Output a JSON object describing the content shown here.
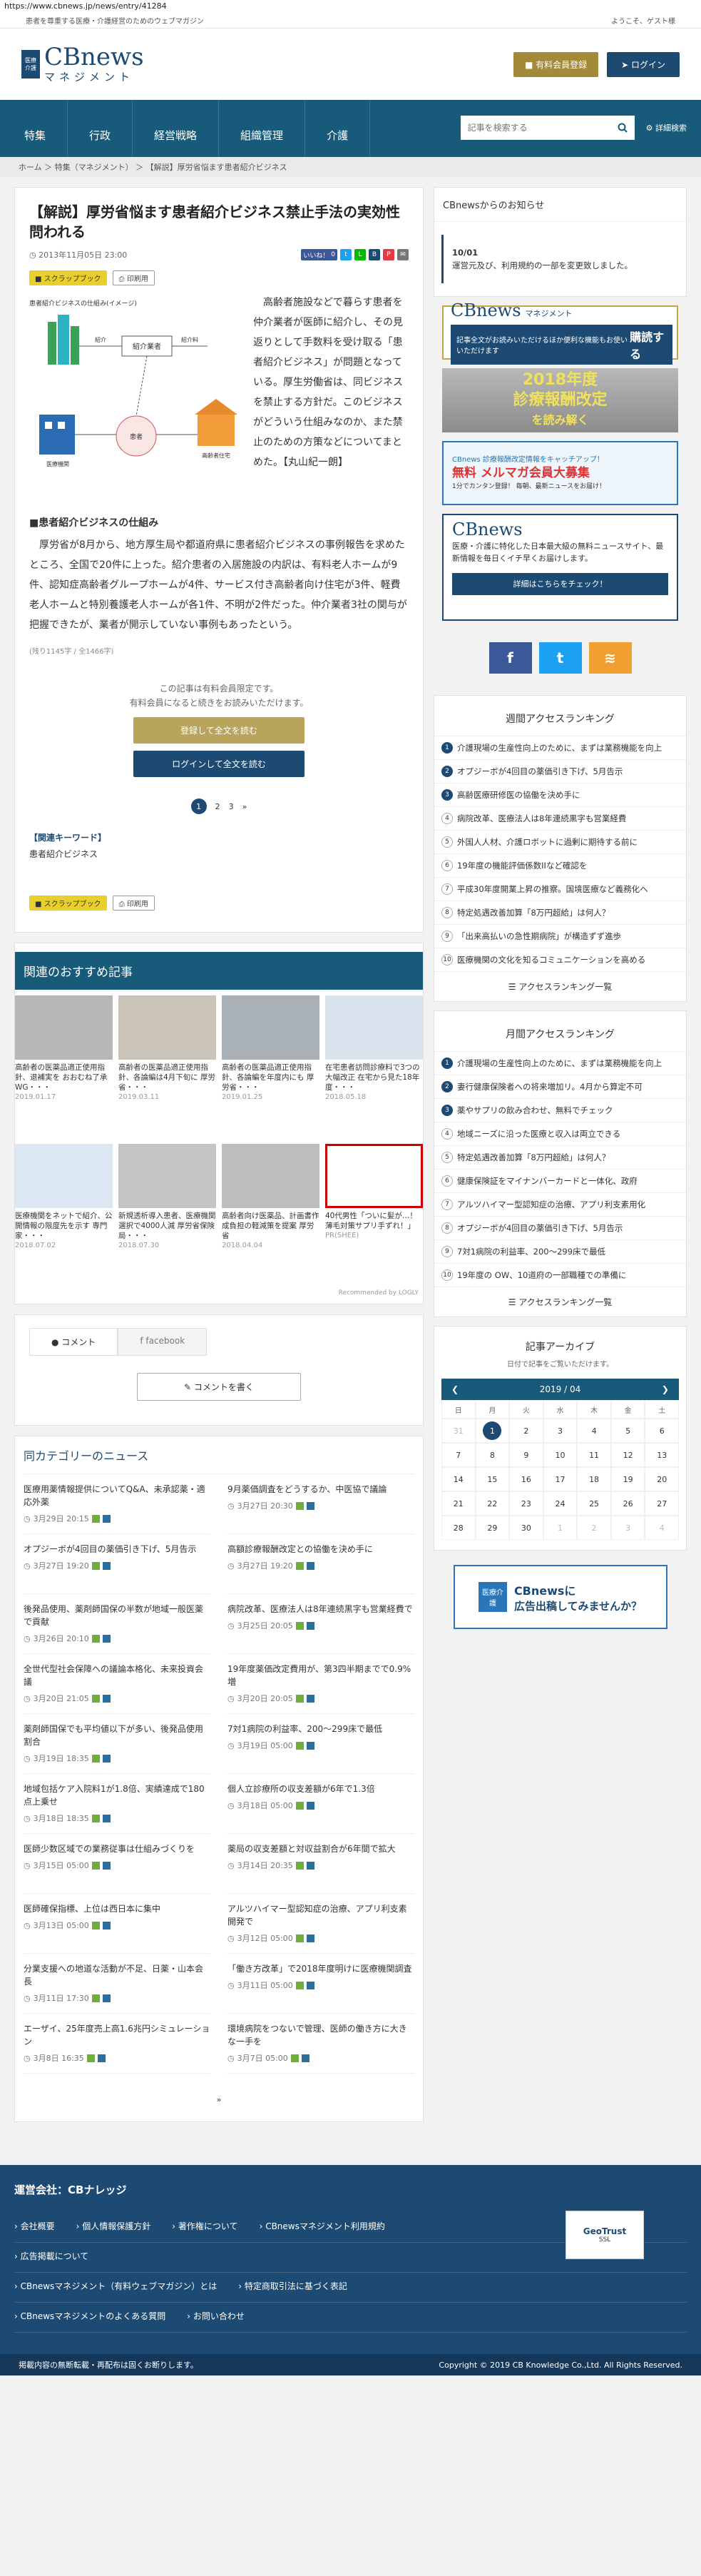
{
  "url": "https://www.cbnews.jp/news/entry/41284",
  "tagline": "患者を尊重する医療・介護経営のためのウェブマガジン",
  "welcome": "ようこそ、ゲスト様",
  "logo": {
    "badge_top": "医療",
    "badge_bottom": "介護",
    "main": "CBnews",
    "sub": "マネジメント"
  },
  "header_buttons": {
    "paid": "有料会員登録",
    "login": "ログイン"
  },
  "nav": [
    "特集",
    "行政",
    "経営戦略",
    "組織管理",
    "介護"
  ],
  "search": {
    "placeholder": "記事を検索する",
    "advanced": "詳細検索"
  },
  "breadcrumb": "ホーム ＞ 特集（マネジメント） ＞ 【解説】厚労省悩ます患者紹介ビジネス",
  "article": {
    "title": "【解説】厚労省悩ます患者紹介ビジネス禁止手法の実効性問われる",
    "date": "2013年11月05日 23:00",
    "share": {
      "like": "いいね！",
      "count": "0"
    },
    "scrapbook": "スクラップブック",
    "print": "印刷用",
    "figure_title": "患者紹介ビジネスの仕組み(イメージ)",
    "figure_labels": [
      "紹介業者",
      "紹介",
      "紹介料",
      "高齢者住宅",
      "患者",
      "医療機関"
    ],
    "lead": "高齢者施設などで暮らす患者を仲介業者が医師に紹介し、その見返りとして手数料を受け取る「患者紹介ビジネス」が問題となっている。厚生労働省は、同ビジネスを禁止する方針だ。このビジネスがどういう仕組みなのか、また禁止のための方策などについてまとめた。【丸山紀一朗】",
    "section": "■患者紹介ビジネスの仕組み",
    "body": "厚労省が8月から、地方厚生局や都道府県に患者紹介ビジネスの事例報告を求めたところ、全国で20件に上った。紹介患者の入居施設の内訳は、有料老人ホームが9件、認知症高齢者グループホームが4件、サービス付き高齢者向け住宅が3件、軽費老人ホームと特別養護老人ホームが各1件、不明が2件だった。仲介業者3社の関与が把握できたが、業者が開示していない事例もあったという。",
    "remain": "(残り1145字 / 全1466字)",
    "lock1": "この記事は有料会員限定です。",
    "lock2": "有料会員になると続きをお読みいただけます。",
    "register": "登録して全文を読む",
    "login_read": "ログインして全文を読む",
    "pages": [
      "1",
      "2",
      "3",
      "»"
    ],
    "keyword_title": "【関連キーワード】",
    "keyword": "患者紹介ビジネス"
  },
  "recommend": {
    "title": "関連のおすすめ記事",
    "items": [
      {
        "t": "高齢者の医薬品適正使用指針、退補実を おおむね了承 WG・・・",
        "d": "2019.01.17"
      },
      {
        "t": "高齢者の医薬品適正使用指針、各論編は4月下旬に 厚労省・・・",
        "d": "2019.03.11"
      },
      {
        "t": "高齢者の医薬品適正使用指針、各論編を年度内にも 厚労省・・・",
        "d": "2019.01.25"
      },
      {
        "t": "在宅患者訪問診療料で3つの大幅改正 在宅から見た18年度・・・",
        "d": "2018.05.18"
      },
      {
        "t": "医療機関をネットで紹介、公開情報の限度先を示す 専門家・・・",
        "d": "2018.07.02"
      },
      {
        "t": "新規透析導入患者、医療機関選択で4000人減 厚労省保険局・・・",
        "d": "2018.07.30"
      },
      {
        "t": "高齢者向け医薬品、計画書作成負担の軽減策を提案 厚労省",
        "d": "2018.04.04"
      },
      {
        "t": "40代男性「ついに髪が…！薄毛対策サプリ手ずれ！」",
        "d": "PR(SHEE)"
      }
    ],
    "credit": "Recommended by LOGLY"
  },
  "comments": {
    "tab1": "コメント",
    "tab2": "facebook",
    "write": "コメントを書く"
  },
  "news": {
    "title": "同カテゴリーのニュース",
    "items": [
      {
        "t": "医療用薬情報提供についてQ&A、未承認薬・適応外薬",
        "d": "3月29日 20:15"
      },
      {
        "t": "9月薬価調査をどうするか、中医協で議論",
        "d": "3月27日 20:30"
      },
      {
        "t": "オプジーボが4回目の薬価引き下げ、5月告示",
        "d": "3月27日 19:20"
      },
      {
        "t": "高額診療報酬改定との協働を決め手に",
        "d": "3月27日 19:20"
      },
      {
        "t": "後発品使用、薬剤師国保の半数が地域一般医薬で貢献",
        "d": "3月26日 20:10"
      },
      {
        "t": "病院改革、医療法人は8年連続黒字も営業経費で",
        "d": "3月25日 20:05"
      },
      {
        "t": "全世代型社会保障への議論本格化、未来投資会議",
        "d": "3月20日 21:05"
      },
      {
        "t": "19年度薬価改定費用が、第3四半期までで0.9%増",
        "d": "3月20日 20:05"
      },
      {
        "t": "薬剤師国保でも平均値以下が多い、後発品使用割合",
        "d": "3月19日 18:35"
      },
      {
        "t": "7対1病院の利益率、200～299床で最低",
        "d": "3月19日 05:00"
      },
      {
        "t": "地域包括ケア入院料1が1.8倍、実績達成で180点上乗せ",
        "d": "3月18日 18:35"
      },
      {
        "t": "個人立診療所の収支差額が6年で1.3倍",
        "d": "3月18日 05:00"
      },
      {
        "t": "医師少数区域での業務従事は仕組みづくりを",
        "d": "3月15日 05:00"
      },
      {
        "t": "薬局の収支差額と対収益割合が6年間で拡大",
        "d": "3月14日 20:35"
      },
      {
        "t": "医師確保指標、上位は西日本に集中",
        "d": "3月13日 05:00"
      },
      {
        "t": "アルツハイマー型認知症の治療、アプリ利支素開発で",
        "d": "3月12日 05:00"
      },
      {
        "t": "分業支援への地道な活動が不足、日薬・山本会長",
        "d": "3月11日 17:30"
      },
      {
        "t": "「働き方改革」で2018年度明けに医療機関調査",
        "d": "3月11日 05:00"
      },
      {
        "t": "エーザイ、25年度売上高1.6兆円シミュレーション",
        "d": "3月8日 16:35"
      },
      {
        "t": "環境病院をつないで管理、医師の働き方に大きな一手を",
        "d": "3月7日 05:00"
      }
    ],
    "more": "»"
  },
  "side": {
    "notice_title": "CBnewsからのお知らせ",
    "notice_date": "10/01",
    "notice_text": "運営元及び、利用規約の一部を変更致しました。",
    "ad1_top": "CBnews",
    "ad1_sub": "マネジメント",
    "ad1_text": "記事全文がお読みいただけるほか便利な機能もお使いいただけます",
    "ad1_cta": "購読する",
    "ad2_line1": "2018年度",
    "ad2_line2": "診療報酬改定",
    "ad2_line3": "を読み解く",
    "ad3_line1": "CBnews 診療報酬改定情報をキャッチアップ！",
    "ad3_line2": "無料 メルマガ会員大募集",
    "ad3_line3": "1分でカンタン登録！ 毎朝、最新ニュースをお届け！",
    "ad4_logo": "CBnews",
    "ad4_text": "医療・介護に特化した日本最大級の無料ニュースサイト、最新情報を毎日くイチ早くお届けします。",
    "ad4_btn": "詳細はこちらをチェック！",
    "weekly_title": "週間アクセスランキング",
    "weekly": [
      "介護現場の生産性向上のために、まずは業務機能を向上",
      "オプジーボが4回目の薬価引き下げ、5月告示",
      "高齢医療研修医の協働を決め手に",
      "病院改革、医療法人は8年連続黒字も営業経費",
      "外国人人材、介護ロボットに過剰に期待する前に",
      "19年度の機能評価係数IIなど確認を",
      "平成30年度開業上昇の推察。国境医療など義務化へ",
      "特定処遇改善加算「8万円超給」は何人？",
      "「出来高払いの急性期病院」が構造ずず進歩",
      "医療機関の文化を知るコミュニケーションを高める"
    ],
    "weekly_more": "アクセスランキング一覧",
    "monthly_title": "月間アクセスランキング",
    "monthly": [
      "介護現場の生産性向上のために、まずは業務機能を向上",
      "妻行健康保険者への将来増加リ。4月から算定不可",
      "薬やサプリの飲み合わせ、無料でチェック",
      "地域ニーズに沿った医療と収入は両立できる",
      "特定処遇改善加算「8万円超給」は何人？",
      "健康保険証をマイナンバーカードと一体化、政府",
      "アルツハイマー型認知症の治療、アプリ利支素用化",
      "オプジーボが4回目の薬価引き下げ、5月告示",
      "7対1病院の利益率、200～299床で最低",
      "19年度の OW、10道府の一部職種での準備に"
    ],
    "monthly_more": "アクセスランキング一覧",
    "archive_title": "記事アーカイブ",
    "archive_sub": "日付で記事をご覧いただけます。",
    "cal_month": "2019 / 04",
    "dow": [
      "日",
      "月",
      "火",
      "水",
      "木",
      "金",
      "土"
    ],
    "days": [
      "31",
      "1",
      "2",
      "3",
      "4",
      "5",
      "6",
      "7",
      "8",
      "9",
      "10",
      "11",
      "12",
      "13",
      "14",
      "15",
      "16",
      "17",
      "18",
      "19",
      "20",
      "21",
      "22",
      "23",
      "24",
      "25",
      "26",
      "27",
      "28",
      "29",
      "30",
      "1",
      "2",
      "3",
      "4"
    ],
    "ad5_badge": "医療介護",
    "ad5_line1": "CBnewsに",
    "ad5_line2": "広告出稿してみませんか？"
  },
  "footer": {
    "company": "運営会社：CBナレッジ",
    "row1": [
      "会社概要",
      "個人情報保護方針",
      "著作権について",
      "CBnewsマネジメント利用規約"
    ],
    "row2": [
      "広告掲載について"
    ],
    "row3": [
      "CBnewsマネジメント（有料ウェブマガジン）とは",
      "特定商取引法に基づく表記"
    ],
    "row4": [
      "CBnewsマネジメントのよくある質問",
      "お問い合わせ"
    ],
    "gtrust_top": "GeoTrust",
    "gtrust_bottom": "SSL",
    "bottom_left": "掲載内容の無断転載・再配布は固くお断りします。",
    "bottom_right": "Copyright © 2019 CB Knowledge Co.,Ltd. All Rights Reserved."
  }
}
